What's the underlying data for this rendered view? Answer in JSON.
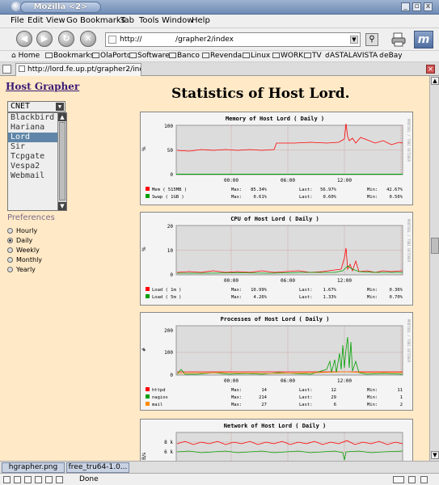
{
  "window": {
    "title": "Mozilla <2>",
    "buttons": [
      "_",
      "▫",
      "x"
    ]
  },
  "menu": [
    "File",
    "Edit",
    "View",
    "Go",
    "Bookmarks",
    "Tab",
    "Tools",
    "Window",
    "Help"
  ],
  "nav": {
    "url_prefix": "http://",
    "url_path": "/grapher2/index",
    "icons": [
      "back-icon",
      "forward-icon",
      "reload-icon",
      "stop-icon",
      "go-icon",
      "print-icon",
      "throbber-icon"
    ]
  },
  "bookmarks": [
    "Home",
    "Bookmarks",
    "OlaPorto",
    "Software",
    "Banco",
    "Revenda",
    "Linux",
    "WORK",
    "TV",
    "ASTALAVISTA",
    "eBay"
  ],
  "tab": {
    "label": "http://lord.fe.up.pt/grapher2/index"
  },
  "sidebar": {
    "title": "Host Grapher",
    "domain_select": "CNET",
    "hosts": [
      "Blackbird",
      "Hariana",
      "Lord",
      "Sir",
      "Tcpgate",
      "Vespa2",
      "Webmail"
    ],
    "selected_host": "Lord",
    "preferences_label": "Preferences",
    "periods": [
      "Hourly",
      "Daily",
      "Weekly",
      "Monthly",
      "Yearly"
    ],
    "selected_period": "Daily"
  },
  "page": {
    "title": "Statistics of Host Lord."
  },
  "graphs": {
    "memory": {
      "title": "Memory of Host Lord ( Daily )",
      "side_text": "RRDTOOL / TOBI OETIKER",
      "y_unit": "%",
      "yticks": [
        "100",
        "50",
        "0"
      ],
      "xticks": [
        "00:00",
        "06:00",
        "12:00"
      ],
      "legend": [
        [
          "Mem  ( 515MB )",
          "Max:",
          "85.34%",
          "Last:",
          "56.97%",
          "Min:",
          "42.67%"
        ],
        [
          "Swap ( 1GB )",
          "Max:",
          "0.61%",
          "Last:",
          "0.60%",
          "Min:",
          "0.56%"
        ]
      ]
    },
    "cpu": {
      "title": "CPU of Host Lord ( Daily )",
      "side_text": "RRDTOOL / TOBI OETIKER",
      "y_unit": "%",
      "yticks": [
        "20",
        "10",
        "0"
      ],
      "xticks": [
        "00:00",
        "06:00",
        "12:00"
      ],
      "legend": [
        [
          "Load ( 1m )",
          "Max:",
          "10.99%",
          "Last:",
          "1.67%",
          "Min:",
          "0.36%"
        ],
        [
          "Load ( 5m )",
          "Max:",
          "4.26%",
          "Last:",
          "1.33%",
          "Min:",
          "0.70%"
        ]
      ]
    },
    "processes": {
      "title": "Processes of Host Lord ( Daily )",
      "side_text": "RRDTOOL / TOBI OETIKER",
      "y_unit": "#",
      "yticks": [
        "200",
        "100",
        "0"
      ],
      "xticks": [
        "00:00",
        "06:00",
        "12:00"
      ],
      "legend": [
        [
          "httpd",
          "Max:",
          "14",
          "Last:",
          "12",
          "Min:",
          "11"
        ],
        [
          "nagios",
          "Max:",
          "214",
          "Last:",
          "29",
          "Min:",
          "1"
        ],
        [
          "mail",
          "Max:",
          "27",
          "Last:",
          "6",
          "Min:",
          "2"
        ]
      ]
    },
    "network": {
      "title": "Network of Host Lord ( Daily )",
      "y_unit": "B/s",
      "yticks": [
        "8 k",
        "6 k"
      ]
    }
  },
  "taskbar": [
    "hgrapher.png",
    "free_tru64-1.0..."
  ],
  "status": {
    "text": "Done"
  },
  "colors": {
    "page_bg": "#ffe9c6",
    "series_red": "#ff0000",
    "series_green": "#00a000",
    "series_orange": "#ff8c00"
  }
}
